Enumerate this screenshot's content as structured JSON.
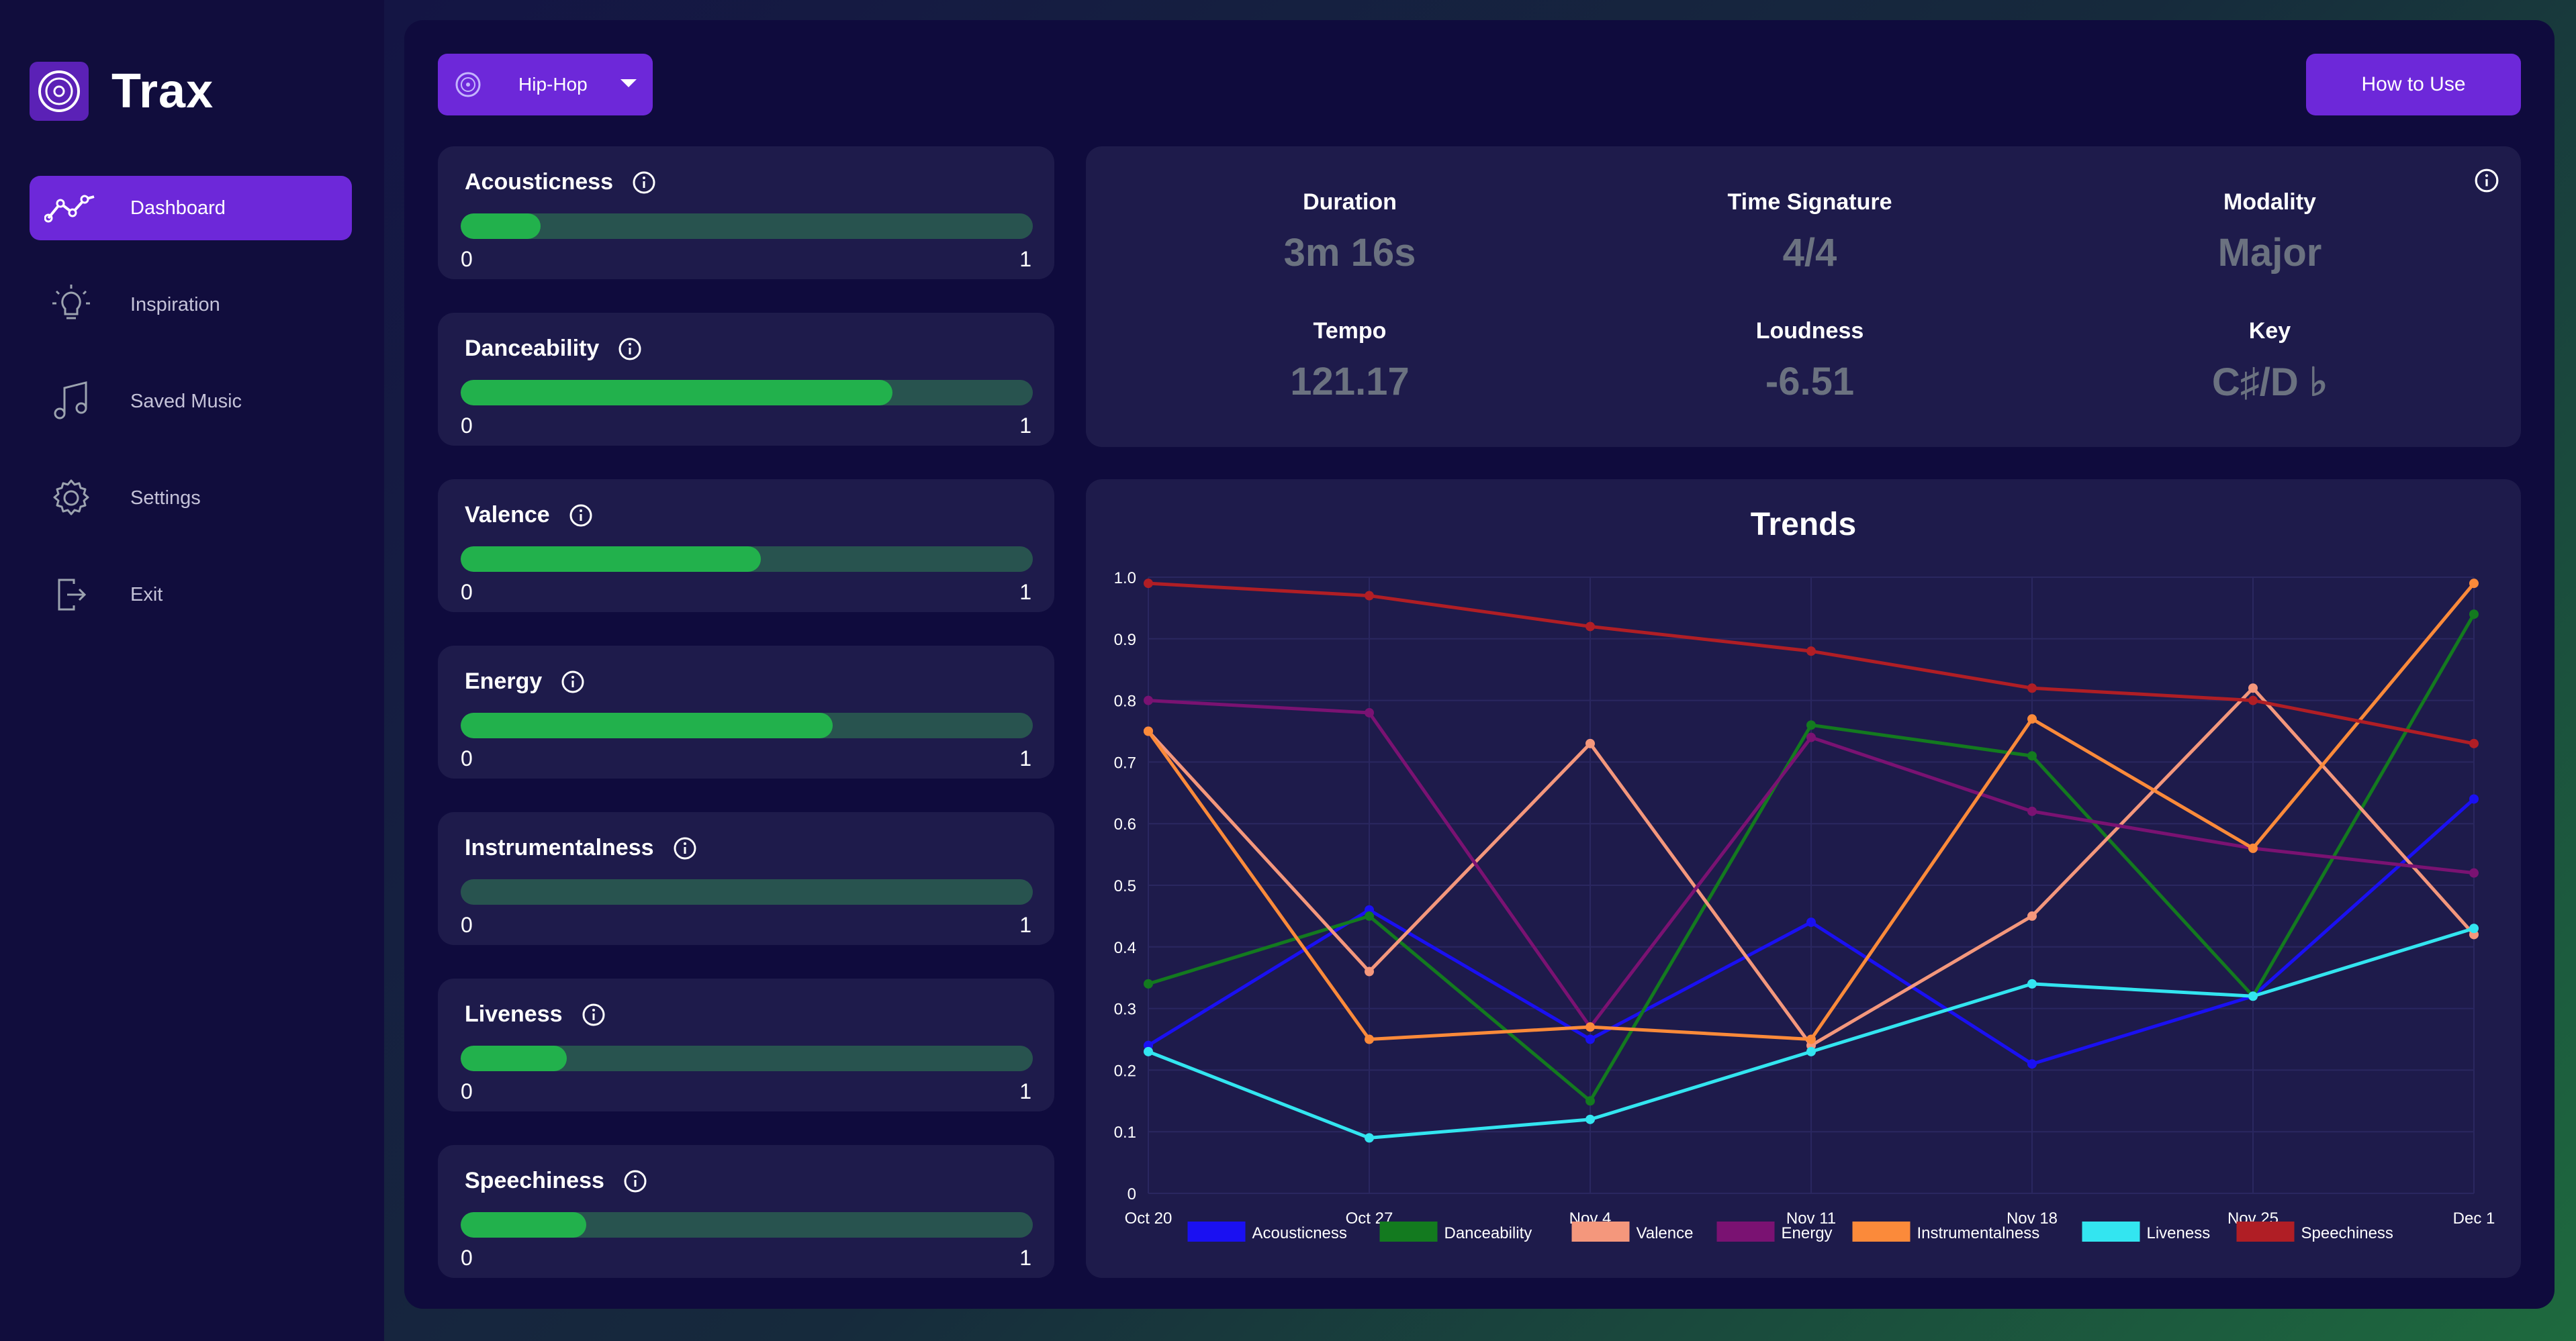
{
  "app": {
    "name": "Trax"
  },
  "sidebar": {
    "items": [
      {
        "label": "Dashboard",
        "icon": "trend-line-icon",
        "active": true
      },
      {
        "label": "Inspiration",
        "icon": "lightbulb-icon",
        "active": false
      },
      {
        "label": "Saved Music",
        "icon": "music-note-icon",
        "active": false
      },
      {
        "label": "Settings",
        "icon": "gear-icon",
        "active": false
      },
      {
        "label": "Exit",
        "icon": "exit-icon",
        "active": false
      }
    ]
  },
  "header": {
    "genre": "Hip-Hop",
    "how_to_use": "How to Use"
  },
  "features": [
    {
      "label": "Acousticness",
      "value": 0.14,
      "min": "0",
      "max": "1"
    },
    {
      "label": "Danceability",
      "value": 0.755,
      "min": "0",
      "max": "1"
    },
    {
      "label": "Valence",
      "value": 0.525,
      "min": "0",
      "max": "1"
    },
    {
      "label": "Energy",
      "value": 0.65,
      "min": "0",
      "max": "1"
    },
    {
      "label": "Instrumentalness",
      "value": 0.0,
      "min": "0",
      "max": "1"
    },
    {
      "label": "Liveness",
      "value": 0.185,
      "min": "0",
      "max": "1"
    },
    {
      "label": "Speechiness",
      "value": 0.22,
      "min": "0",
      "max": "1"
    }
  ],
  "stats": [
    {
      "label": "Duration",
      "value": "3m 16s"
    },
    {
      "label": "Time Signature",
      "value": "4/4"
    },
    {
      "label": "Modality",
      "value": "Major"
    },
    {
      "label": "Tempo",
      "value": "121.17"
    },
    {
      "label": "Loudness",
      "value": "-6.51"
    },
    {
      "label": "Key",
      "value": "C♯/D ♭"
    }
  ],
  "chart_data": {
    "type": "line",
    "title": "Trends",
    "x": [
      "Oct 20",
      "Oct 27",
      "Nov 4",
      "Nov 11",
      "Nov 18",
      "Nov 25",
      "Dec 1"
    ],
    "ylim": [
      0,
      1.0
    ],
    "yticks": [
      "0",
      "0.1",
      "0.2",
      "0.3",
      "0.4",
      "0.5",
      "0.6",
      "0.7",
      "0.8",
      "0.9",
      "1.0"
    ],
    "grid": true,
    "legend": "bottom",
    "series": [
      {
        "name": "Acousticness",
        "color": "#1a10f2",
        "values": [
          0.24,
          0.46,
          0.25,
          0.44,
          0.21,
          0.32,
          0.64
        ]
      },
      {
        "name": "Danceability",
        "color": "#137a1f",
        "values": [
          0.34,
          0.45,
          0.15,
          0.76,
          0.71,
          0.32,
          0.94
        ]
      },
      {
        "name": "Valence",
        "color": "#f4977c",
        "values": [
          0.75,
          0.36,
          0.73,
          0.24,
          0.45,
          0.82,
          0.42
        ]
      },
      {
        "name": "Energy",
        "color": "#7a1272",
        "values": [
          0.8,
          0.78,
          0.27,
          0.74,
          0.62,
          0.56,
          0.52
        ]
      },
      {
        "name": "Instrumentalness",
        "color": "#fb8a3a",
        "values": [
          0.75,
          0.25,
          0.27,
          0.25,
          0.77,
          0.56,
          0.99
        ]
      },
      {
        "name": "Liveness",
        "color": "#33e5f0",
        "values": [
          0.23,
          0.09,
          0.12,
          0.23,
          0.34,
          0.32,
          0.43
        ]
      },
      {
        "name": "Speechiness",
        "color": "#b01e25",
        "values": [
          0.99,
          0.97,
          0.92,
          0.88,
          0.82,
          0.8,
          0.73
        ]
      }
    ]
  }
}
